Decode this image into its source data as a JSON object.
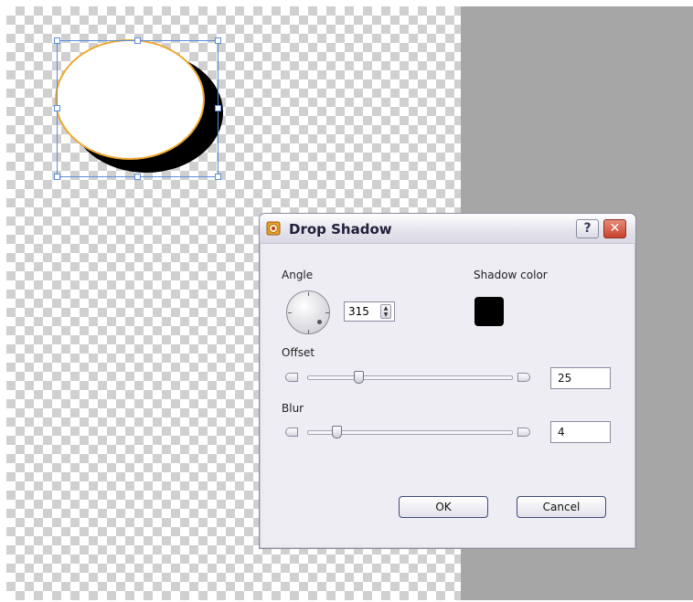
{
  "dialog": {
    "title": "Drop Shadow",
    "help_label": "?",
    "close_label": "✕",
    "angle": {
      "label": "Angle",
      "value": "315"
    },
    "shadow_color": {
      "label": "Shadow color",
      "color": "#000000"
    },
    "offset": {
      "label": "Offset",
      "value": "25"
    },
    "blur": {
      "label": "Blur",
      "value": "4"
    },
    "ok_label": "OK",
    "cancel_label": "Cancel"
  },
  "canvas": {
    "shape": "ellipse",
    "shape_outline_color": "#f0a830",
    "selection_color": "#5b8ddb"
  }
}
